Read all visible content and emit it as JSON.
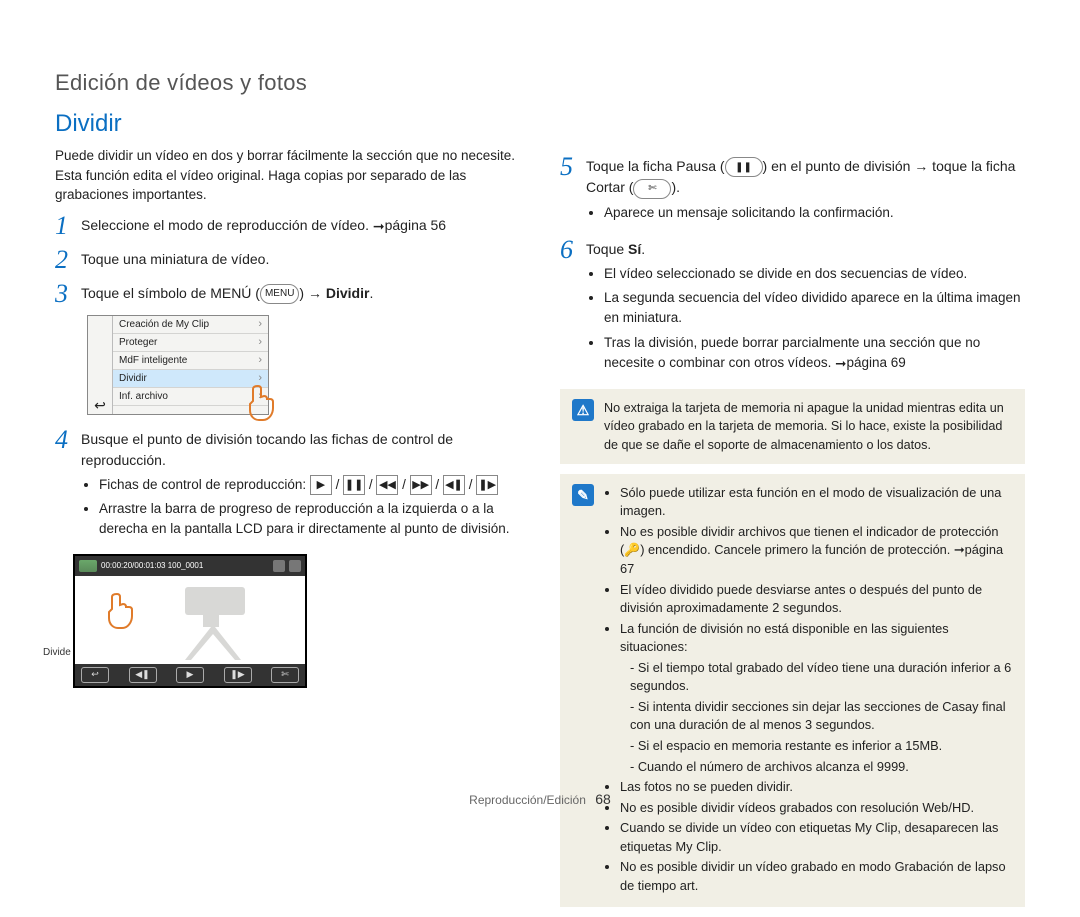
{
  "chapter": "Edición de vídeos y fotos",
  "section": "Dividir",
  "intro": "Puede dividir un vídeo en dos y borrar fácilmente la sección que no necesite. Esta función edita el vídeo original. Haga copias por separado de las grabaciones importantes.",
  "steps": {
    "s1": {
      "num": "1",
      "text_a": "Seleccione el modo de reproducción de vídeo. ",
      "arrow": "➞",
      "text_b": "página 56"
    },
    "s2": {
      "num": "2",
      "text": "Toque una miniatura de vídeo."
    },
    "s3": {
      "num": "3",
      "text_a": "Toque el símbolo de MENÚ (",
      "pill": "MENU",
      "text_b": ") → ",
      "bold": "Dividir",
      "text_c": "."
    },
    "s4": {
      "num": "4",
      "text": "Busque el punto de división tocando las fichas de control de reproducción.",
      "bullet1_a": "Fichas de control de reproducción: ",
      "ctrl_icons": [
        "▶",
        "❚❚",
        "◀◀",
        "▶▶",
        "◀❚",
        "❚▶"
      ],
      "bullet2": "Arrastre la barra de progreso de reproducción a la izquierda o a la derecha en la pantalla LCD para ir directamente al punto de división."
    },
    "s5": {
      "num": "5",
      "text_a": "Toque la ficha Pausa (",
      "icon1": "❚❚",
      "text_b": ") en el punto de división → toque la ficha Cortar (",
      "icon2": "✄",
      "text_c": ").",
      "bullet": "Aparece un mensaje solicitando la confirmación."
    },
    "s6": {
      "num": "6",
      "text_a": "Toque ",
      "bold": "Sí",
      "text_b": ".",
      "b1": "El vídeo seleccionado se divide en dos secuencias de vídeo.",
      "b2": "La segunda secuencia del vídeo dividido aparece en la última imagen en miniatura.",
      "b3_a": "Tras la división, puede borrar parcialmente una sección que no necesite o combinar con otros vídeos. ",
      "b3_arrow": "➞",
      "b3_b": "página 69"
    }
  },
  "fig_menu": {
    "items": [
      "Creación de My Clip",
      "Proteger",
      "MdF inteligente",
      "Dividir",
      "Inf. archivo"
    ],
    "highlight_index": 3,
    "back": "↩"
  },
  "fig_player": {
    "time": "00:00:20/00:01:03   100_0001",
    "side_label": "Divide",
    "bottom": [
      "↩",
      "◀❚",
      "▶",
      "❚▶",
      "✄"
    ]
  },
  "warn_note": "No extraiga la tarjeta de memoria ni apague la unidad mientras edita un vídeo grabado en la tarjeta de memoria. Si lo hace, existe la posibilidad de que se dañe el soporte de almacenamiento o los datos.",
  "info_note": {
    "li1": "Sólo puede utilizar esta función en el modo de visualización de una imagen.",
    "li2_a": "No es posible dividir archivos que tienen el indicador de protección (",
    "li2_key": "🔑",
    "li2_b": ") encendido. Cancele primero la función de protección. ➞página 67",
    "li3": "El vídeo dividido puede desviarse antes o después del punto de división aproximadamente 2 segundos.",
    "li4": "La función de división no está disponible en las siguientes situaciones:",
    "li4a": "- Si el tiempo total grabado del vídeo tiene una duración inferior a 6 segundos.",
    "li4b": "- Si intenta dividir secciones sin dejar las secciones de Casay final con una duración de al menos 3 segundos.",
    "li4c": "- Si el espacio en memoria restante es inferior a 15MB.",
    "li4d": "- Cuando el número de archivos alcanza el 9999.",
    "li5": "Las fotos no se pueden dividir.",
    "li6": "No es posible dividir vídeos grabados con resolución Web/HD.",
    "li7": "Cuando se divide un vídeo con etiquetas My Clip, desaparecen las etiquetas My Clip.",
    "li8": "No es posible dividir un vídeo grabado en modo Grabación de lapso de tiempo art."
  },
  "footer": {
    "section": "Reproducción/Edición",
    "page": "68"
  }
}
